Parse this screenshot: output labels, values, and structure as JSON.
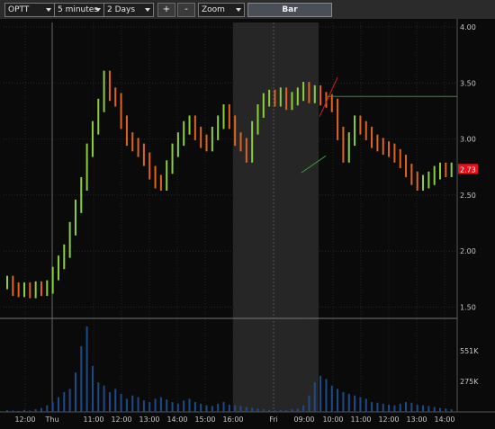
{
  "toolbar": {
    "symbol": "OPTT",
    "interval": "5 minutes",
    "range": "2 Days",
    "zoom_in": "+",
    "zoom_out": "-",
    "zoom": "Zoom",
    "chart_style": "Bar"
  },
  "colors": {
    "up": "#8ccf3a",
    "down": "#e0641e",
    "session_shade": "#262626",
    "volume": "#1d4b8a",
    "price_tag": "#e8101a"
  },
  "price_axis": {
    "ticks": [
      "4.00",
      "3.50",
      "3.00",
      "2.50",
      "2.00",
      "1.50"
    ]
  },
  "volume_axis": {
    "ticks": [
      "551K",
      "275K"
    ]
  },
  "last_price_tag": "2.73",
  "time_axis": {
    "labels": [
      "12:00",
      "Thu",
      "11:00",
      "12:00",
      "13:00",
      "14:00",
      "15:00",
      "16:00",
      "Fri",
      "09:00",
      "10:00",
      "11:00",
      "12:00",
      "13:00",
      "14:00"
    ]
  },
  "chart_data": {
    "type": "line",
    "title": "",
    "xlabel": "",
    "ylabel": "",
    "ylim": [
      1.4,
      4.0
    ],
    "grid": true,
    "series": [
      {
        "values": [
          1.72,
          1.66,
          1.65,
          1.66,
          1.64,
          1.67,
          1.66,
          1.68,
          1.8,
          1.9,
          2.0,
          2.2,
          2.4,
          2.6,
          2.9,
          3.1,
          3.3,
          3.55,
          3.4,
          3.35,
          3.15,
          3.0,
          2.95,
          2.9,
          2.82,
          2.7,
          2.62,
          2.6,
          2.75,
          2.9,
          3.0,
          3.1,
          3.15,
          3.05,
          2.98,
          2.95,
          3.05,
          3.15,
          3.25,
          3.15,
          3.0,
          2.95,
          2.85,
          3.1,
          3.25,
          3.35,
          3.38,
          3.35,
          3.4,
          3.32,
          3.36,
          3.4,
          3.45,
          3.38,
          3.42,
          3.36,
          3.34,
          3.3,
          3.05,
          2.85,
          3.0,
          3.15,
          3.1,
          3.05,
          2.98,
          2.95,
          2.92,
          2.9,
          2.85,
          2.8,
          2.72,
          2.65,
          2.6,
          2.62,
          2.65,
          2.7,
          2.73,
          2.72,
          2.73
        ]
      }
    ],
    "volume": [
      5,
      4,
      3,
      6,
      4,
      8,
      12,
      20,
      30,
      45,
      60,
      70,
      120,
      200,
      260,
      140,
      90,
      80,
      60,
      70,
      55,
      40,
      50,
      45,
      35,
      30,
      40,
      45,
      38,
      30,
      25,
      35,
      40,
      30,
      25,
      20,
      18,
      25,
      30,
      22,
      20,
      18,
      15,
      12,
      10,
      8,
      6,
      5,
      6,
      5,
      8,
      10,
      20,
      50,
      90,
      110,
      100,
      80,
      70,
      60,
      55,
      50,
      45,
      40,
      30,
      28,
      25,
      22,
      20,
      25,
      30,
      28,
      22,
      20,
      18,
      15,
      12,
      10,
      8
    ]
  }
}
